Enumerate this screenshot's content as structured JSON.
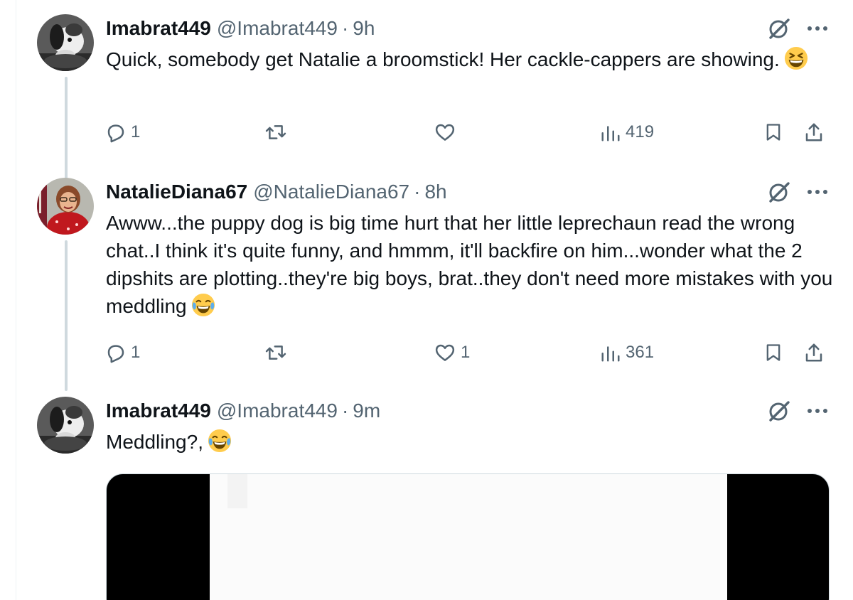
{
  "tweets": [
    {
      "name": "Imabrat449",
      "handle": "@Imabrat449",
      "separator": "·",
      "time": "9h",
      "text": "Quick, somebody get Natalie a broomstick! Her cackle-cappers are showing.",
      "emoji": "grinning-squinting-face",
      "replies": "1",
      "reposts": "",
      "likes": "",
      "views": "419"
    },
    {
      "name": "NatalieDiana67",
      "handle": "@NatalieDiana67",
      "separator": "·",
      "time": "8h",
      "text": "Awww...the puppy dog is big time hurt that her little leprechaun read the wrong chat..I think it's quite funny, and hmmm, it'll backfire on him...wonder what the 2 dipshits are plotting..they're big boys, brat..they don't need more mistakes with you meddling",
      "emoji": "face-with-tears-of-joy",
      "replies": "1",
      "reposts": "",
      "likes": "1",
      "views": "361"
    },
    {
      "name": "Imabrat449",
      "handle": "@Imabrat449",
      "separator": "·",
      "time": "9m",
      "text": "Meddling?,",
      "emoji": "face-with-tears-of-joy"
    }
  ],
  "icons": [
    "grok-icon",
    "more-icon",
    "reply-icon",
    "repost-icon",
    "like-icon",
    "views-icon",
    "bookmark-icon",
    "share-icon"
  ],
  "colors": {
    "text": "#0f1419",
    "secondary": "#536471",
    "thread_line": "#cfd9de",
    "border": "#eff3f4"
  }
}
